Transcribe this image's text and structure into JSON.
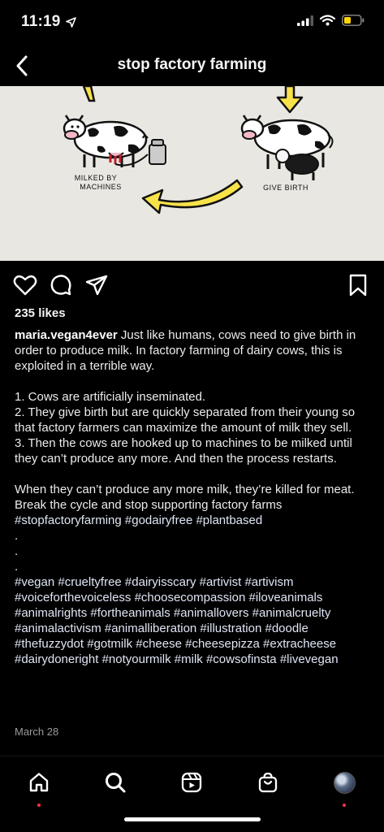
{
  "status_bar": {
    "time": "11:19"
  },
  "header": {
    "title": "stop factory farming"
  },
  "post_image": {
    "label_left": "MILKED BY MACHINES",
    "label_left_line1": "MILKED BY",
    "label_left_line2": "MACHINES",
    "label_right": "GIVE BIRTH",
    "background": "#e9e7e2",
    "arrow_color": "#f7e24a"
  },
  "post": {
    "likes": "235 likes",
    "username": "maria.vegan4ever",
    "caption_intro": " Just like humans, cows need to give birth in order to produce milk. In factory farming of dairy cows, this is exploited in a terrible way.",
    "list": [
      "1. Cows are artificially inseminated.",
      "2. They give birth but are quickly separated from their young so that factory farmers can maximize the amount of milk they sell.",
      "3. Then the cows are hooked up to machines to be milked until they can’t produce any more. And then the process restarts."
    ],
    "closing": "When they can’t produce any more milk, they’re killed for meat. Break the cycle and stop supporting factory farms",
    "tags_line1": "#stopfactoryfarming #godairyfree #plantbased",
    "dots": [
      ".",
      ".",
      "."
    ],
    "hashtags": "#vegan #crueltyfree #dairyisscary #artivist #artivism #voiceforthevoiceless #choosecompassion #iloveanimals #animalrights #fortheanimals #animallovers #animalcruelty #animalactivism #animalliberation #illustration #doodle #thefuzzydot #gotmilk #cheese #cheesepizza #extracheese #dairydoneright #notyourmilk #milk #cowsofinsta #livevegan",
    "date": "March 28"
  },
  "tab_bar": {
    "items": [
      "home",
      "search",
      "reels",
      "shop",
      "profile"
    ],
    "notification_color": "#ff3040"
  }
}
